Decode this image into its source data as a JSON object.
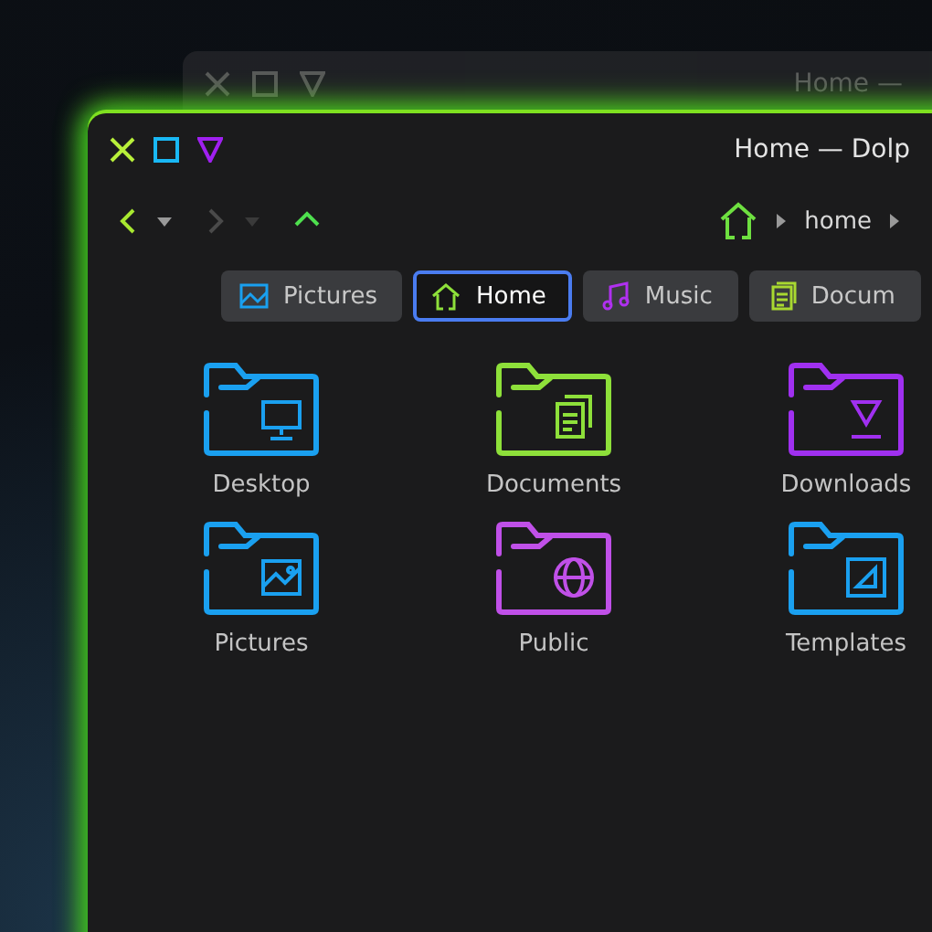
{
  "back_window": {
    "title": "Home —"
  },
  "window": {
    "title": "Home — Dolp"
  },
  "navigation": [
    {
      "kind": "back",
      "disabled": false
    },
    {
      "kind": "forward",
      "disabled": true
    },
    {
      "kind": "up",
      "disabled": false
    }
  ],
  "breadcrumb": [
    "home"
  ],
  "places": [
    {
      "label": "Pictures",
      "kind": "pictures",
      "selected": false
    },
    {
      "label": "Home",
      "kind": "home",
      "selected": true
    },
    {
      "label": "Music",
      "kind": "music",
      "selected": false
    },
    {
      "label": "Docum",
      "kind": "documents",
      "selected": false
    }
  ],
  "folders": [
    {
      "name": "Desktop",
      "kind": "desktop",
      "color": "#1aa0f0"
    },
    {
      "name": "Documents",
      "kind": "documents",
      "color": "#8ee03a"
    },
    {
      "name": "Downloads",
      "kind": "downloads",
      "color": "#a030f0"
    },
    {
      "name": "Pictures",
      "kind": "pictures",
      "color": "#1aa0f0"
    },
    {
      "name": "Public",
      "kind": "public",
      "color": "#c050e8"
    },
    {
      "name": "Templates",
      "kind": "templates",
      "color": "#1aa0f0"
    }
  ]
}
